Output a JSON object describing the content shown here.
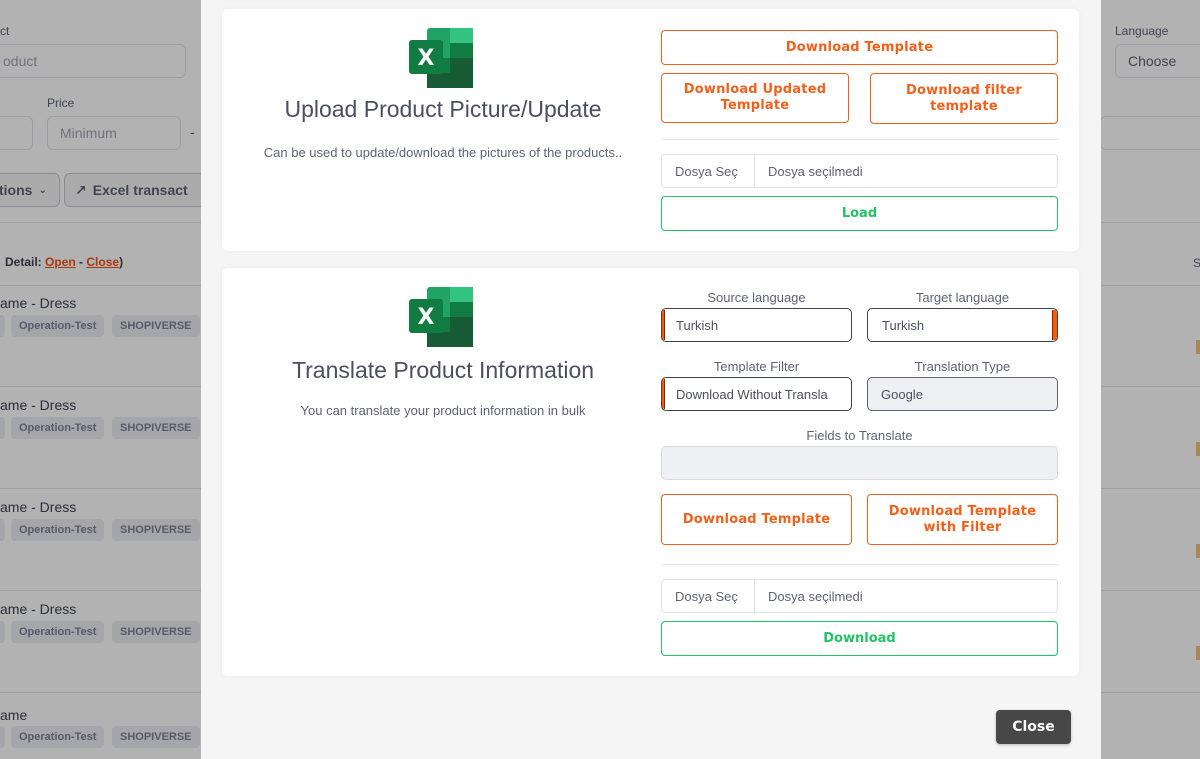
{
  "background": {
    "filter_labels": {
      "product": "ct",
      "price": "Price",
      "language": "Language"
    },
    "inputs": {
      "product_placeholder": "oduct",
      "price_min_placeholder": "Minimum",
      "price_dash": "-",
      "language_value": "Choose"
    },
    "buttons": {
      "actions": "tions",
      "excel": "Excel transact"
    },
    "detail_label": "Detail:",
    "detail_open": "Open",
    "detail_sep": "-",
    "detail_close": "Close",
    "detail_end": ")",
    "right_header": "S",
    "rows": [
      {
        "title": "ame - Dress",
        "tags": [
          "Operation-Test",
          "SHOPIVERSE"
        ]
      },
      {
        "title": "ame - Dress",
        "tags": [
          "Operation-Test",
          "SHOPIVERSE"
        ]
      },
      {
        "title": "ame - Dress",
        "tags": [
          "Operation-Test",
          "SHOPIVERSE"
        ]
      },
      {
        "title": "ame - Dress",
        "tags": [
          "Operation-Test",
          "SHOPIVERSE"
        ]
      },
      {
        "title": "ame",
        "tags": [
          "Operation-Test",
          "SHOPIVERSE"
        ]
      }
    ]
  },
  "modal": {
    "upload_card": {
      "title": "Upload Product Picture/Update",
      "description": "Can be used to update/download the pictures of the products..",
      "download_template": "Download Template",
      "download_updated_template": "Download Updated Template",
      "download_filter_template": "Download filter template",
      "file_pick": "Dosya Seç",
      "file_name": "Dosya seçilmedi",
      "load": "Load"
    },
    "translate_card": {
      "title": "Translate Product Information",
      "description": "You can translate your product information in bulk",
      "source_language_label": "Source language",
      "source_language_value": "Turkish",
      "target_language_label": "Target language",
      "target_language_value": "Turkish",
      "template_filter_label": "Template Filter",
      "template_filter_value": "Download Without Transla",
      "translation_type_label": "Translation Type",
      "translation_type_value": "Google",
      "fields_label": "Fields to Translate",
      "download_template": "Download Template",
      "download_template_with_filter": "Download Template with Filter",
      "file_pick": "Dosya Seç",
      "file_name": "Dosya seçilmedi",
      "download": "Download"
    },
    "close_label": "Close"
  },
  "colors": {
    "accent_orange": "#f1611b",
    "success_green": "#23c266",
    "excel_green": "#107c41",
    "close_button": "#474747"
  }
}
